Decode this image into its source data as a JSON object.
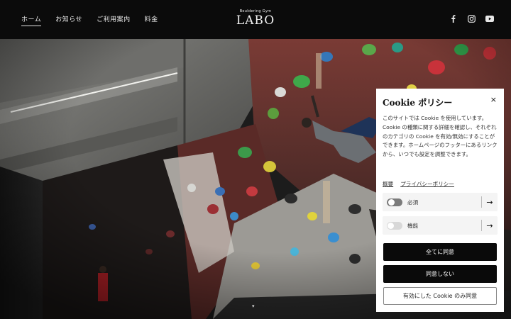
{
  "header": {
    "nav": [
      {
        "label": "ホーム",
        "active": true
      },
      {
        "label": "お知らせ",
        "active": false
      },
      {
        "label": "ご利用案内",
        "active": false
      },
      {
        "label": "料金",
        "active": false
      }
    ],
    "logo_sub": "Bouldering Gym",
    "logo_main": "LABO",
    "social_icons": [
      "facebook-icon",
      "instagram-icon",
      "youtube-icon"
    ]
  },
  "hero": {
    "scroll_glyph": "▾"
  },
  "cookie": {
    "title": "Cookie ポリシー",
    "close_glyph": "×",
    "description": "このサイトでは Cookie を使用しています。Cookie の種類に関する詳細を確認し、それぞれのカテゴリの Cookie を有効/無効にすることができます。ホームページのフッターにあるリンクから、いつでも設定を調整できます。",
    "links": [
      "概要",
      "プライバシーポリシー"
    ],
    "categories": [
      {
        "label": "必須",
        "enabled": true
      },
      {
        "label": "機能",
        "enabled": false
      }
    ],
    "arrow_glyph": "→",
    "buttons": {
      "accept_all": "全てに同意",
      "reject": "同意しない",
      "accept_selected": "有効にした Cookie のみ同意"
    }
  }
}
